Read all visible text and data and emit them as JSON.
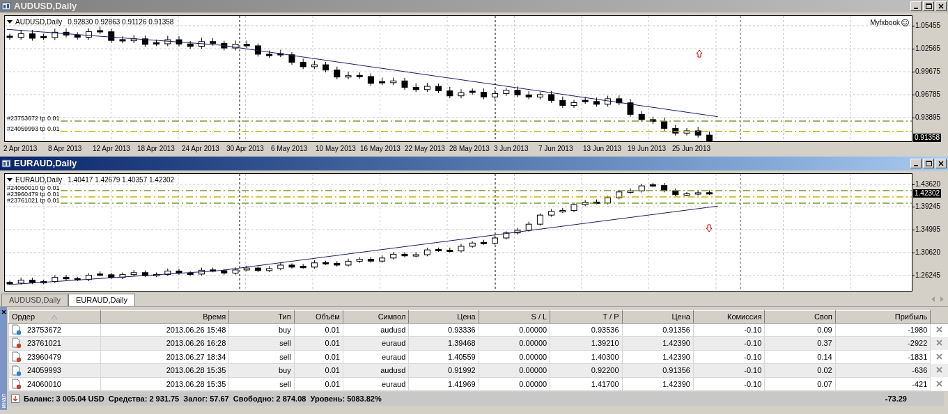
{
  "charts": [
    {
      "title": "AUDUSD,Daily",
      "active": false,
      "symbol": "AUDUSD,Daily",
      "ohlc": "0.92830 0.92863 0.91126 0.91358",
      "watermark": "Myfxbook",
      "price_labels": [
        "1.05455",
        "1.02565",
        "0.99675",
        "0.96785",
        "0.93895"
      ],
      "current_price": "0.91358",
      "order_lines": [
        {
          "label": "#23753672 tp",
          "volume": "0.01"
        },
        {
          "label": "#24059993 tp",
          "volume": "0.01"
        }
      ],
      "date_labels": [
        "2 Apr 2013",
        "8 Apr 2013",
        "12 Apr 2013",
        "18 Apr 2013",
        "24 Apr 2013",
        "30 Apr 2013",
        "6 May 2013",
        "10 May 2013",
        "16 May 2013",
        "22 May 2013",
        "28 May 2013",
        "3 Jun 2013",
        "7 Jun 2013",
        "13 Jun 2013",
        "19 Jun 2013",
        "25 Jun 2013"
      ]
    },
    {
      "title": "EURAUD,Daily",
      "active": true,
      "symbol": "EURAUD,Daily",
      "ohlc": "1.40417 1.42679 1.40357 1.42302",
      "price_labels": [
        "1.43620",
        "1.39245",
        "1.34995",
        "1.30620",
        "1.26245"
      ],
      "current_price": "1.42302",
      "order_lines": [
        {
          "label": "#24060010 tp",
          "volume": "0.01"
        },
        {
          "label": "#23960479 tp",
          "volume": "0.01"
        },
        {
          "label": "#23761021 tp",
          "volume": "0.01"
        }
      ]
    }
  ],
  "tabs": [
    {
      "label": "AUDUSD,Daily",
      "selected": false
    },
    {
      "label": "EURAUD,Daily",
      "selected": true
    }
  ],
  "terminal": {
    "side_label": "инал",
    "columns": [
      "Ордер",
      "Время",
      "Тип",
      "Объём",
      "Символ",
      "Цена",
      "S / L",
      "T / P",
      "Цена",
      "Комиссия",
      "Своп",
      "Прибыль"
    ],
    "rows": [
      {
        "kind": "buy",
        "cells": [
          "23753672",
          "2013.06.26 15:48",
          "buy",
          "0.01",
          "audusd",
          "0.93336",
          "0.00000",
          "0.93536",
          "0.91356",
          "-0.10",
          "0.09",
          "-1980"
        ]
      },
      {
        "kind": "sell",
        "cells": [
          "23761021",
          "2013.06.26 16:28",
          "sell",
          "0.01",
          "euraud",
          "1.39468",
          "0.00000",
          "1.39210",
          "1.42390",
          "-0.10",
          "0.37",
          "-2922"
        ]
      },
      {
        "kind": "sell",
        "cells": [
          "23960479",
          "2013.06.27 18:34",
          "sell",
          "0.01",
          "euraud",
          "1.40559",
          "0.00000",
          "1.40300",
          "1.42390",
          "-0.10",
          "0.14",
          "-1831"
        ]
      },
      {
        "kind": "buy",
        "cells": [
          "24059993",
          "2013.06.28 15:35",
          "buy",
          "0.01",
          "audusd",
          "0.91992",
          "0.00000",
          "0.92200",
          "0.91356",
          "-0.10",
          "0.02",
          "-636"
        ]
      },
      {
        "kind": "sell",
        "cells": [
          "24060010",
          "2013.06.28 15:35",
          "sell",
          "0.01",
          "euraud",
          "1.41969",
          "0.00000",
          "1.41700",
          "1.42390",
          "-0.10",
          "0.07",
          "-421"
        ]
      }
    ],
    "summary": "Баланс: 3 005.04 USD  Средства: 2 931.75  Залог: 57.67  Свободно: 2 874.08  Уровень: 5083.82%",
    "total_profit": "-73.29"
  }
}
